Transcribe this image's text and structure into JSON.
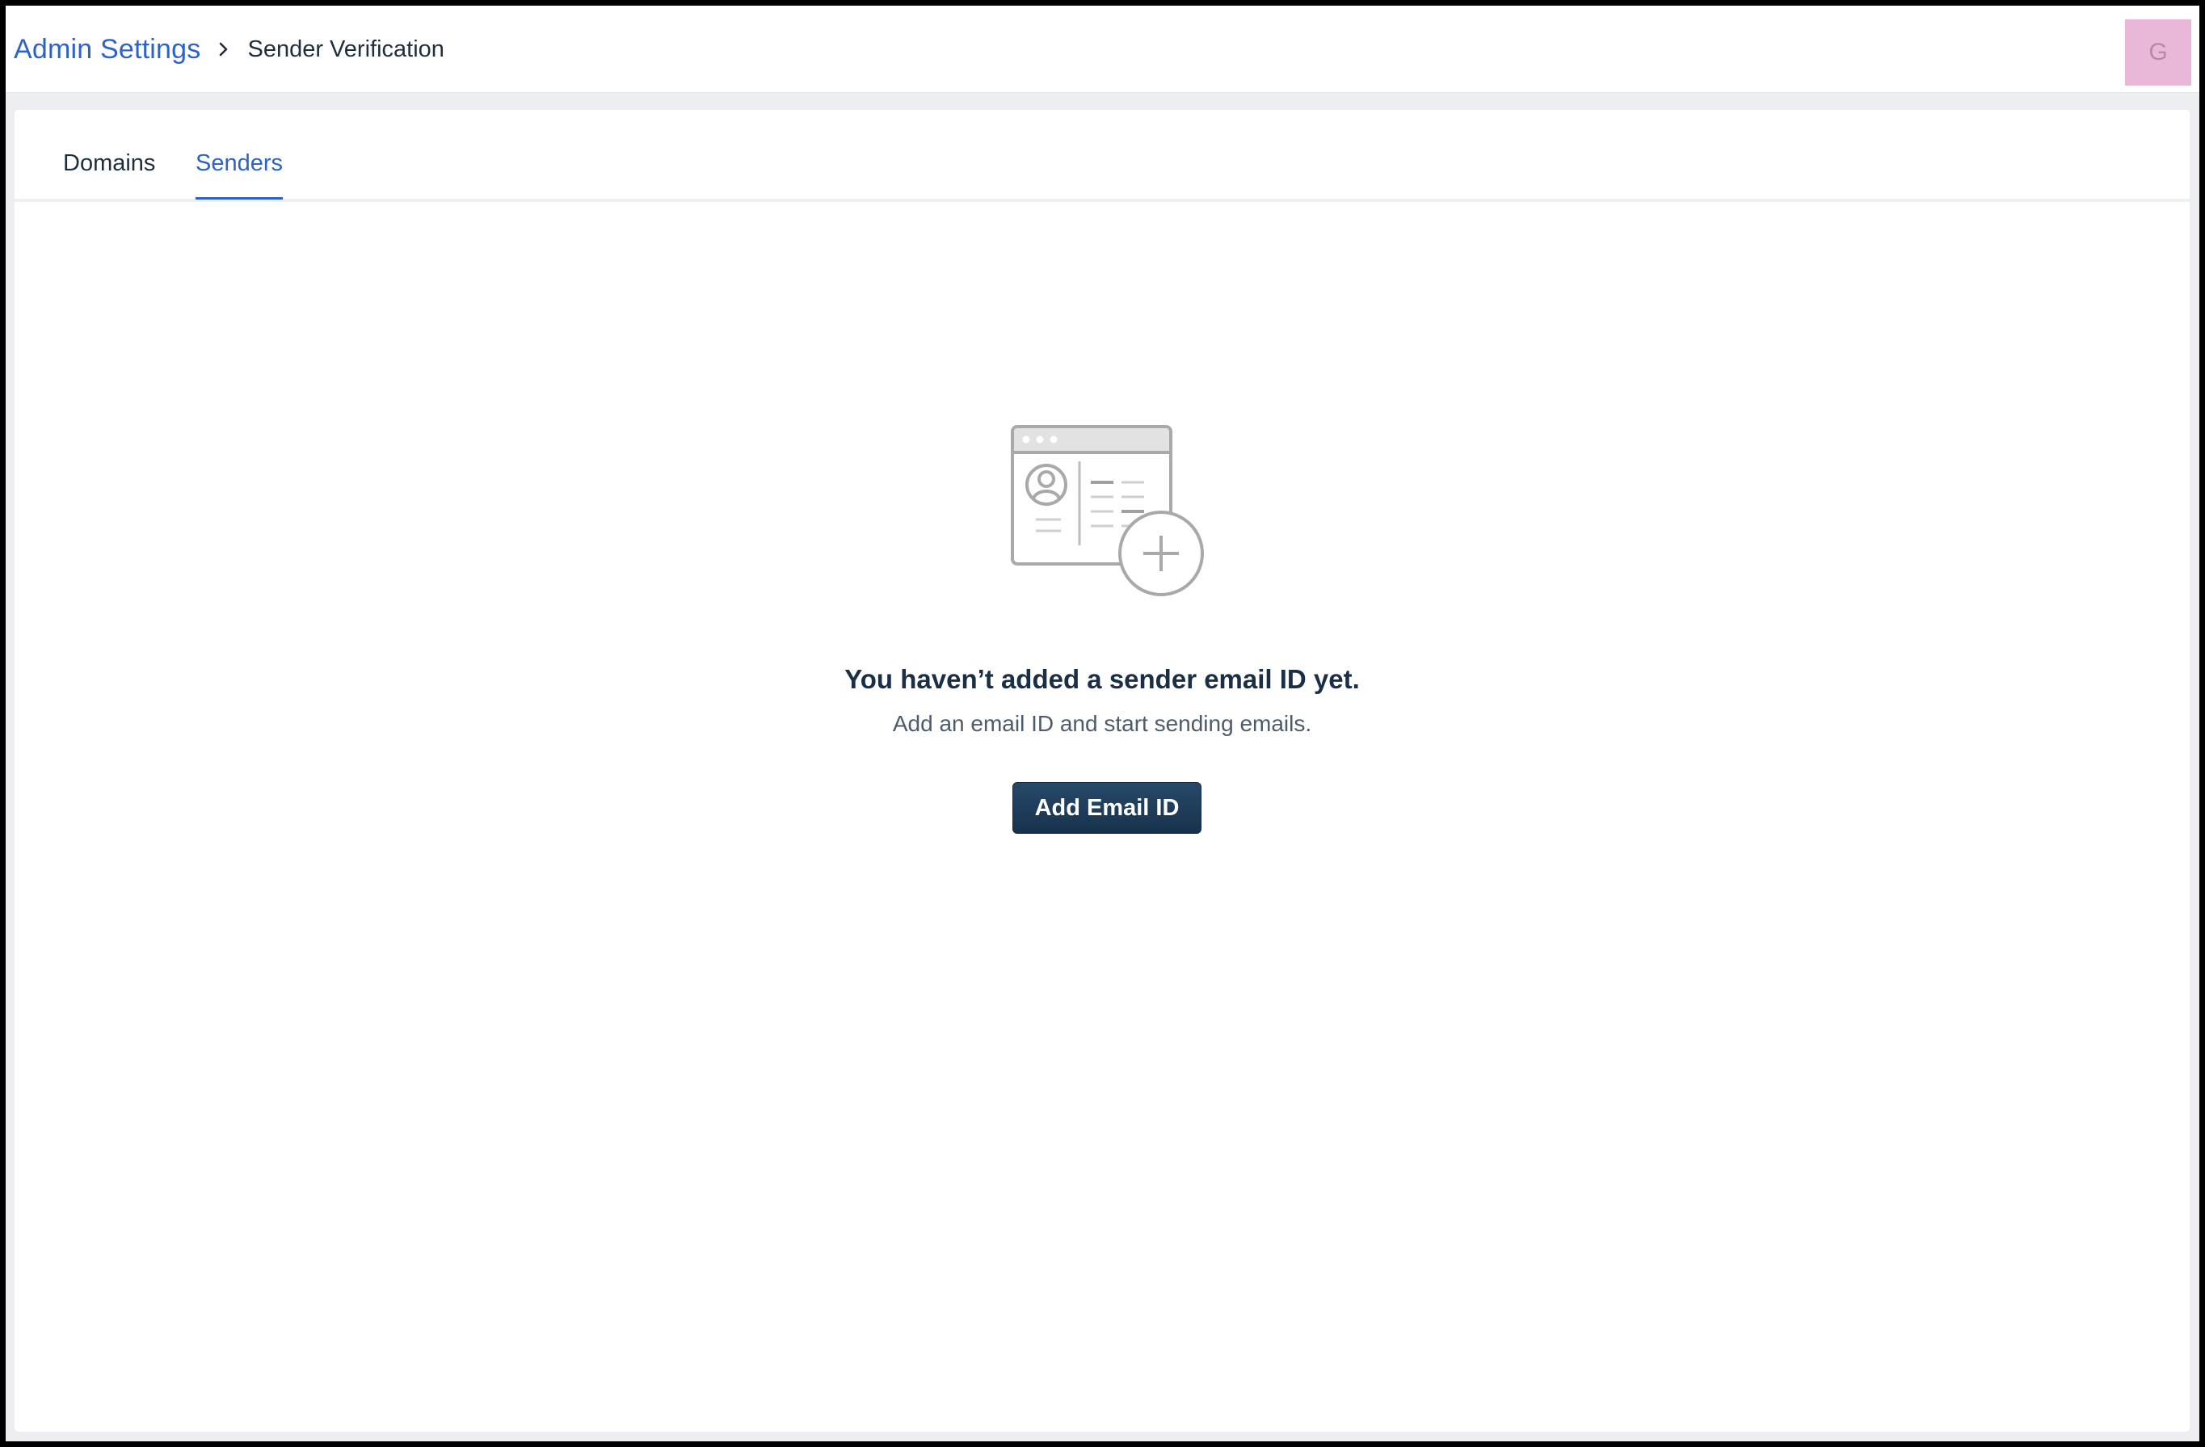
{
  "header": {
    "breadcrumb": {
      "root": "Admin Settings",
      "current": "Sender Verification"
    },
    "avatar_initial": "G"
  },
  "tabs": [
    {
      "label": "Domains",
      "active": false
    },
    {
      "label": "Senders",
      "active": true
    }
  ],
  "empty_state": {
    "illustration_icon": "add-contact-card-icon",
    "title": "You haven’t added a sender email ID yet.",
    "subtitle": "Add an email ID and start sending emails.",
    "button_label": "Add Email ID"
  },
  "colors": {
    "accent": "#2d62c7",
    "primary_button": "#1d3a57",
    "avatar_bg": "#e9b7d8",
    "page_bg": "#eceef2"
  }
}
